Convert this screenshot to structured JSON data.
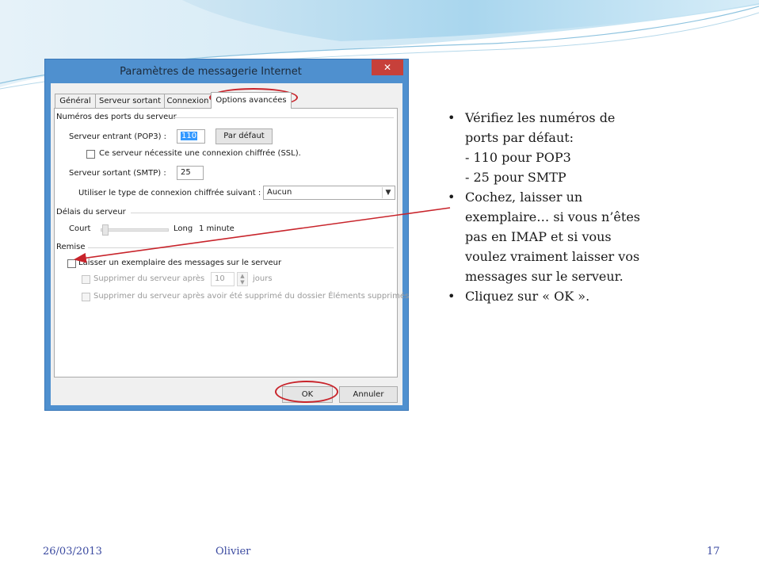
{
  "dialog": {
    "title": "Paramètres de messagerie Internet",
    "close_glyph": "✕",
    "tabs": [
      {
        "label": "Général"
      },
      {
        "label": "Serveur sortant"
      },
      {
        "label": "Connexion"
      },
      {
        "label": "Options avancées",
        "active": true
      }
    ],
    "ports_group": "Numéros des ports du serveur",
    "incoming_label": "Serveur entrant (POP3) :",
    "incoming_value": "110",
    "default_button": "Par défaut",
    "ssl_label": "Ce serveur nécessite une connexion chiffrée (SSL).",
    "outgoing_label": "Serveur sortant (SMTP) :",
    "outgoing_value": "25",
    "encryption_label": "Utiliser le type de connexion chiffrée suivant :",
    "encryption_value": "Aucun",
    "timeout_group": "Délais du serveur",
    "timeout_short": "Court",
    "timeout_long": "Long",
    "timeout_value": "1 minute",
    "timeout_level": 0.02,
    "delivery_group": "Remise",
    "leave_copy_label": "Laisser un exemplaire des messages sur le serveur",
    "remove_after_label": "Supprimer du serveur après",
    "remove_after_value": "10",
    "remove_after_unit": "jours",
    "remove_deleted_label": "Supprimer du serveur après avoir été supprimé du dossier Éléments supprimés",
    "ok_button": "OK",
    "cancel_button": "Annuler"
  },
  "notes": {
    "bullet_glyph": "•",
    "item1_line1": "Vérifiez les numéros de",
    "item1_line2": "ports par défaut:",
    "item1_sub1": "- 110 pour POP3",
    "item1_sub2": "-  25 pour SMTP",
    "item2_line1": "Cochez, laisser un",
    "item2_line2": "exemplaire… si vous n’êtes",
    "item2_line3": "pas en IMAP et si vous",
    "item2_line4": "voulez vraiment laisser  vos",
    "item2_line5": "messages sur le serveur.",
    "item3": "Cliquez sur « OK »."
  },
  "footer": {
    "date": "26/03/2013",
    "author": "Olivier",
    "page": "17"
  },
  "colors": {
    "annotation_red": "#c8242b",
    "dialog_border": "#4f90cf",
    "footer_text": "#3b4aa0"
  }
}
